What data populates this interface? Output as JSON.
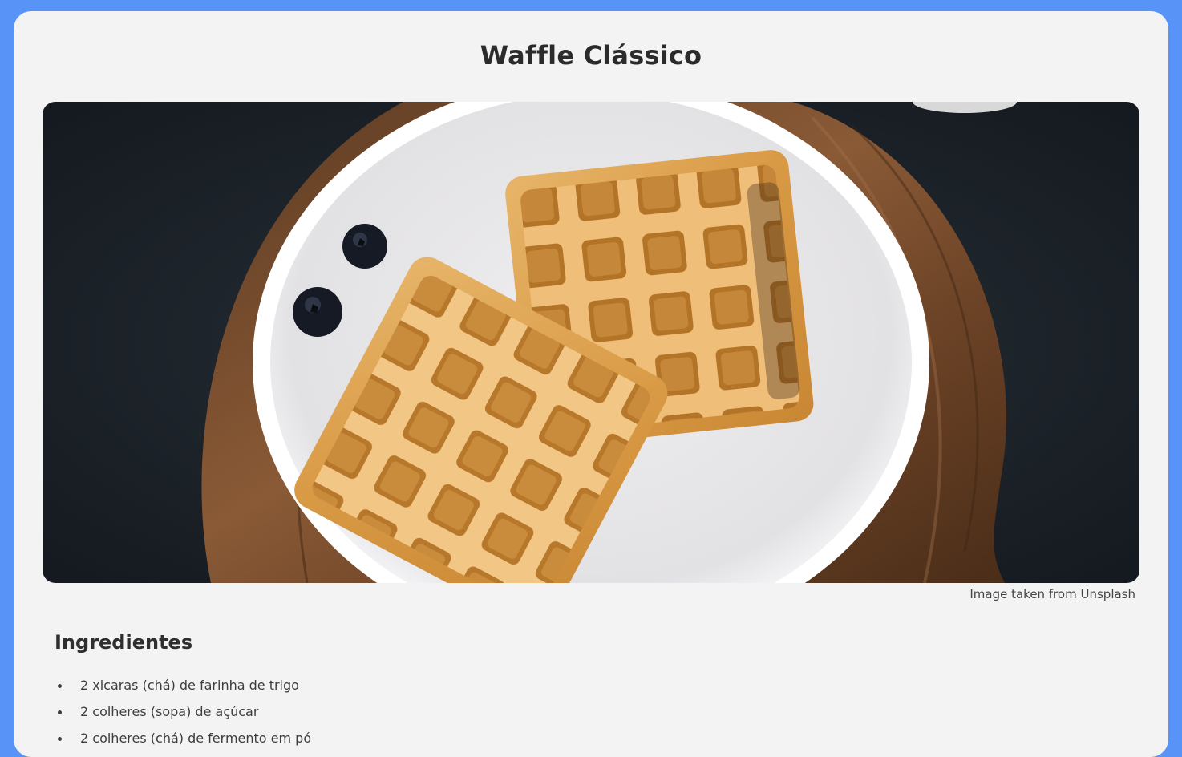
{
  "recipe": {
    "title": "Waffle Clássico",
    "image_alt": "Dois waffles em um prato branco com mirtilos",
    "image_caption": "Image taken from Unsplash"
  },
  "ingredients": {
    "heading": "Ingredientes",
    "items": [
      "2 xicaras (chá) de farinha de trigo",
      "2 colheres (sopa) de açúcar",
      "2 colheres (chá) de fermento em pó"
    ]
  },
  "colors": {
    "page_background": "#5893f7",
    "card_background": "#f3f3f3",
    "text": "#2b2b2b"
  }
}
